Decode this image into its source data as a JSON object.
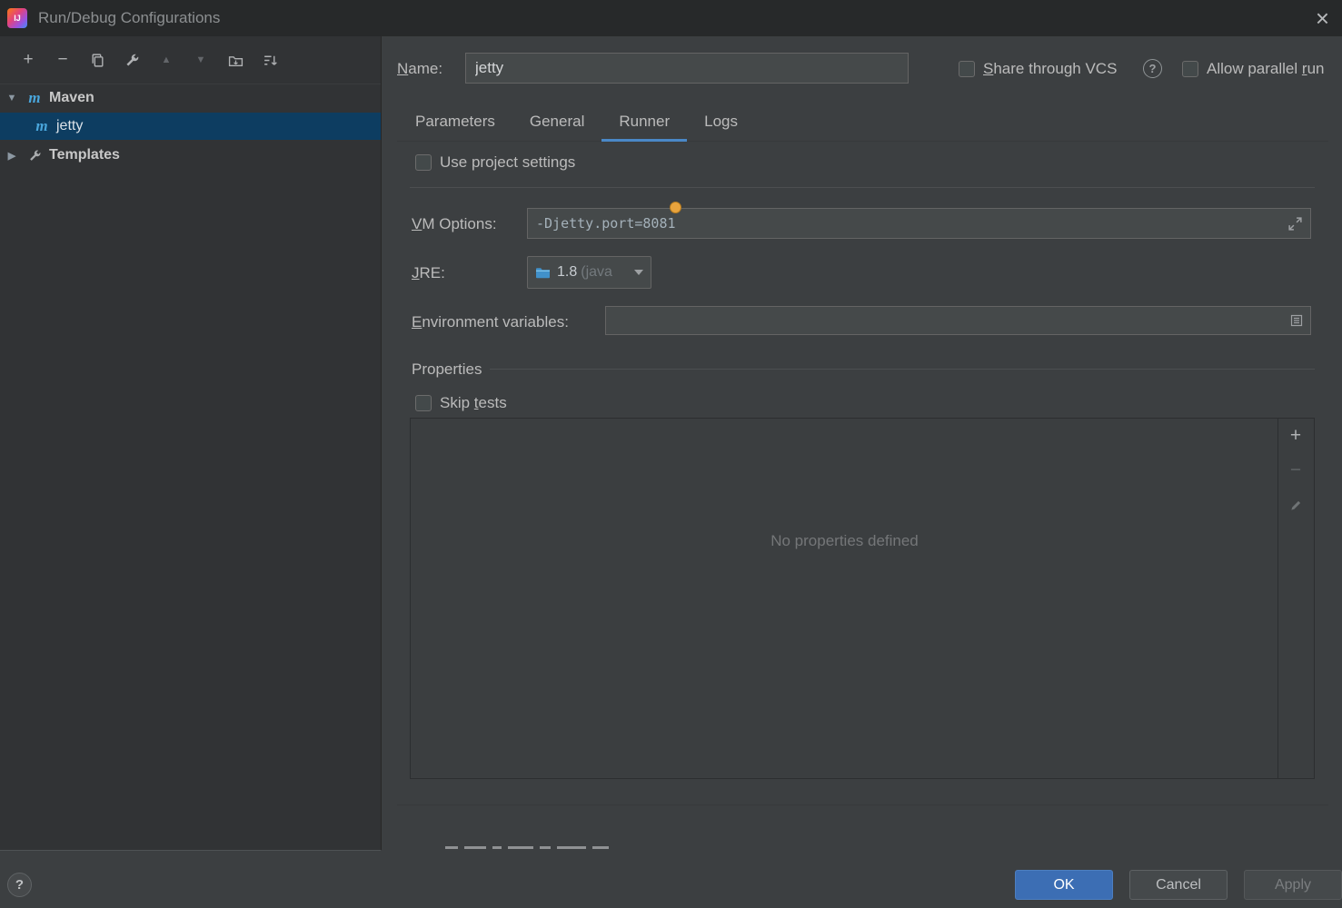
{
  "colors": {
    "accent": "#4a88c7",
    "selection": "#0d3d61",
    "ok_button": "#3c6eb4",
    "bulb": "#e8a33d",
    "maven_icon": "#49a6dc"
  },
  "titlebar": {
    "title": "Run/Debug Configurations",
    "logo": "IJ",
    "close": "×"
  },
  "sidebar": {
    "toolbar": {
      "add": "+",
      "remove": "−",
      "move_up": "▲",
      "move_down": "▼"
    },
    "tree": {
      "maven_icon": "m",
      "maven_label": "Maven",
      "jetty_icon": "m",
      "jetty_label": "jetty",
      "templates_label": "Templates",
      "maven_expander": "▼",
      "templates_expander": "▶"
    }
  },
  "header": {
    "name_label_key": "N",
    "name_label_rest": "ame:",
    "name_value": "jetty",
    "share_key": "S",
    "share_rest": "hare through VCS",
    "help": "?",
    "allow_pre": "Allow parallel ",
    "allow_key": "r",
    "allow_rest": "un"
  },
  "tabs": {
    "parameters": "Parameters",
    "general": "General",
    "runner": "Runner",
    "logs": "Logs"
  },
  "content": {
    "use_project_settings": "Use project settings",
    "vm_label_key": "V",
    "vm_label_rest": "M Options:",
    "vm_value": "-Djetty.port=8081",
    "jre_label_key": "J",
    "jre_label_rest": "RE:",
    "jre_version": "1.8",
    "jre_detail": "(java",
    "env_label_key": "E",
    "env_label_rest": "nvironment variables:",
    "env_value": "",
    "properties_title": "Properties",
    "skip_pre": "Skip ",
    "skip_key": "t",
    "skip_rest": "ests",
    "empty_message": "No properties defined"
  },
  "footer": {
    "help": "?",
    "ok": "OK",
    "cancel": "Cancel",
    "apply": "Apply"
  }
}
